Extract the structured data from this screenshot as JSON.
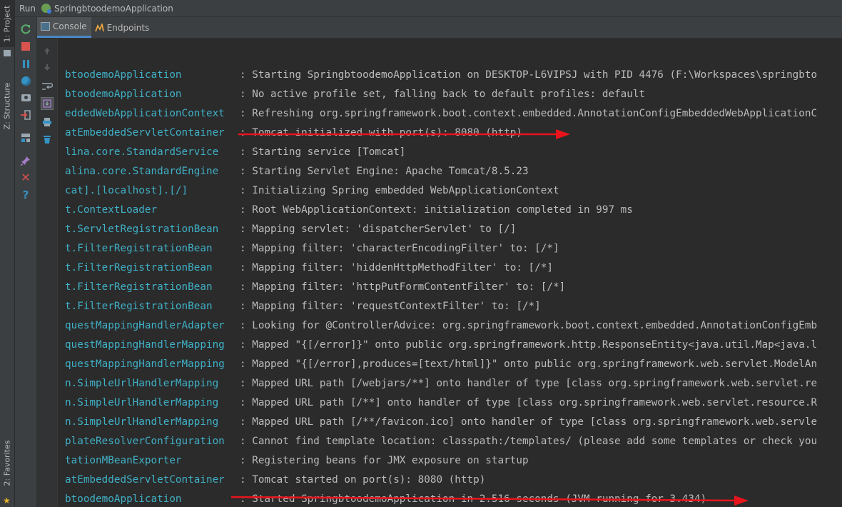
{
  "left_stripe": {
    "project_tab": "1: Project",
    "structure_tab": "Z: Structure",
    "favorites_tab": "2: Favorites"
  },
  "run_header": {
    "label": "Run",
    "config_name": "SpringbtoodemoApplication"
  },
  "tabs": [
    {
      "label": "Console",
      "icon": "console-icon",
      "active": true
    },
    {
      "label": "Endpoints",
      "icon": "endpoints-icon",
      "active": false
    }
  ],
  "toolbar_icons": [
    "rerun-icon",
    "stop-icon",
    "pause-icon",
    "globe-icon",
    "camera-icon",
    "login-icon",
    "layout-icon",
    "pin-icon",
    "close-icon",
    "help-icon"
  ],
  "toolbar2_icons": [
    "scroll-up-icon",
    "scroll-down-icon",
    "soft-wrap-icon",
    "scroll-to-end-icon",
    "print-icon",
    "trash-icon"
  ],
  "console": {
    "separator": ":",
    "lines": [
      {
        "logger": "btoodemoApplication",
        "message": "Starting SpringbtoodemoApplication on DESKTOP-L6VIPSJ with PID 4476 (F:\\Workspaces\\springbto"
      },
      {
        "logger": "btoodemoApplication",
        "message": "No active profile set, falling back to default profiles: default"
      },
      {
        "logger": "eddedWebApplicationContext",
        "message": "Refreshing org.springframework.boot.context.embedded.AnnotationConfigEmbeddedWebApplicationC"
      },
      {
        "logger": "atEmbeddedServletContainer",
        "message": "Tomcat initialized with port(s): 8080 (http)"
      },
      {
        "logger": "lina.core.StandardService",
        "message": "Starting service [Tomcat]"
      },
      {
        "logger": "alina.core.StandardEngine",
        "message": "Starting Servlet Engine: Apache Tomcat/8.5.23"
      },
      {
        "logger": "cat].[localhost].[/]",
        "message": "Initializing Spring embedded WebApplicationContext"
      },
      {
        "logger": "t.ContextLoader",
        "message": "Root WebApplicationContext: initialization completed in 997 ms"
      },
      {
        "logger": "t.ServletRegistrationBean",
        "message": "Mapping servlet: 'dispatcherServlet' to [/]"
      },
      {
        "logger": "t.FilterRegistrationBean",
        "message": "Mapping filter: 'characterEncodingFilter' to: [/*]"
      },
      {
        "logger": "t.FilterRegistrationBean",
        "message": "Mapping filter: 'hiddenHttpMethodFilter' to: [/*]"
      },
      {
        "logger": "t.FilterRegistrationBean",
        "message": "Mapping filter: 'httpPutFormContentFilter' to: [/*]"
      },
      {
        "logger": "t.FilterRegistrationBean",
        "message": "Mapping filter: 'requestContextFilter' to: [/*]"
      },
      {
        "logger": "questMappingHandlerAdapter",
        "message": "Looking for @ControllerAdvice: org.springframework.boot.context.embedded.AnnotationConfigEmb"
      },
      {
        "logger": "questMappingHandlerMapping",
        "message": "Mapped \"{[/error]}\" onto public org.springframework.http.ResponseEntity<java.util.Map<java.l"
      },
      {
        "logger": "questMappingHandlerMapping",
        "message": "Mapped \"{[/error],produces=[text/html]}\" onto public org.springframework.web.servlet.ModelAn"
      },
      {
        "logger": "n.SimpleUrlHandlerMapping",
        "message": "Mapped URL path [/webjars/**] onto handler of type [class org.springframework.web.servlet.re"
      },
      {
        "logger": "n.SimpleUrlHandlerMapping",
        "message": "Mapped URL path [/**] onto handler of type [class org.springframework.web.servlet.resource.R"
      },
      {
        "logger": "n.SimpleUrlHandlerMapping",
        "message": "Mapped URL path [/**/favicon.ico] onto handler of type [class org.springframework.web.servle"
      },
      {
        "logger": "plateResolverConfiguration",
        "message": "Cannot find template location: classpath:/templates/ (please add some templates or check you"
      },
      {
        "logger": "tationMBeanExporter",
        "message": "Registering beans for JMX exposure on startup"
      },
      {
        "logger": "atEmbeddedServletContainer",
        "message": "Tomcat started on port(s): 8080 (http)"
      },
      {
        "logger": "btoodemoApplication",
        "message": "Started SpringbtoodemoApplication in 2.516 seconds (JVM running for 3.434)"
      }
    ]
  },
  "colors": {
    "logger": "#3fb0c6",
    "text": "#bbbbbb",
    "background": "#2b2b2b",
    "annotation": "#e8141c"
  }
}
